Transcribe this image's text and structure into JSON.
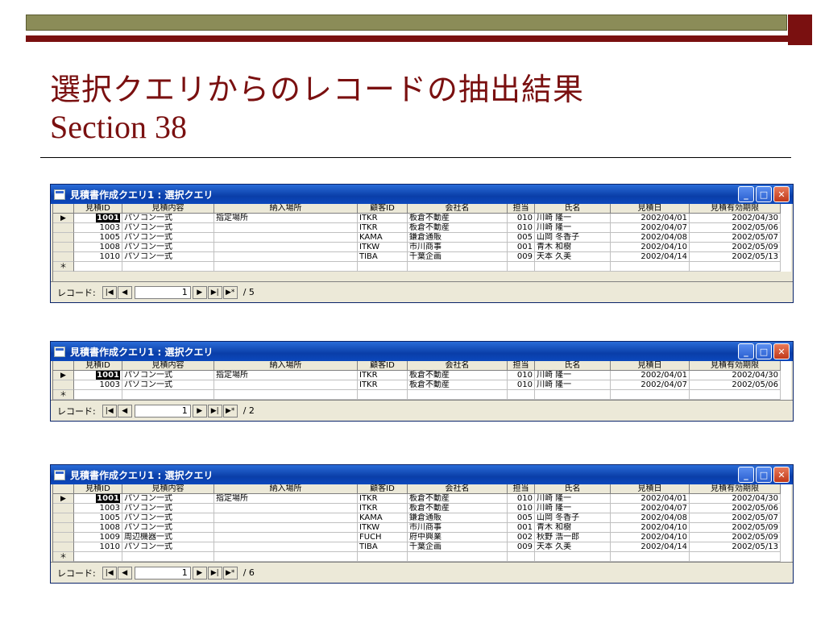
{
  "slide": {
    "title": "選択クエリからのレコードの抽出結果",
    "subtitle": "Section 38"
  },
  "windows": [
    {
      "title": "見積書作成クエリ1 : 選択クエリ",
      "columns": [
        "見積ID",
        "見積内容",
        "納入場所",
        "顧客ID",
        "会社名",
        "担当",
        "氏名",
        "見積日",
        "見積有効期限"
      ],
      "rows": [
        [
          "1001",
          "パソコン一式",
          "指定場所",
          "ITKR",
          "板倉不動産",
          "010",
          "川崎 隆一",
          "2002/04/01",
          "2002/04/30"
        ],
        [
          "1003",
          "パソコン一式",
          "",
          "ITKR",
          "板倉不動産",
          "010",
          "川崎 隆一",
          "2002/04/07",
          "2002/05/06"
        ],
        [
          "1005",
          "パソコン一式",
          "",
          "KAMA",
          "鎌倉通販",
          "005",
          "山岡 冬香子",
          "2002/04/08",
          "2002/05/07"
        ],
        [
          "1008",
          "パソコン一式",
          "",
          "ITKW",
          "市川商事",
          "001",
          "青木 和樹",
          "2002/04/10",
          "2002/05/09"
        ],
        [
          "1010",
          "パソコン一式",
          "",
          "TIBA",
          "千葉企画",
          "009",
          "天本 久美",
          "2002/04/14",
          "2002/05/13"
        ]
      ],
      "nav": {
        "label": "レコード:",
        "current": "1",
        "total": "/ 5"
      }
    },
    {
      "title": "見積書作成クエリ1 : 選択クエリ",
      "columns": [
        "見積ID",
        "見積内容",
        "納入場所",
        "顧客ID",
        "会社名",
        "担当",
        "氏名",
        "見積日",
        "見積有効期限"
      ],
      "rows": [
        [
          "1001",
          "パソコン一式",
          "指定場所",
          "ITKR",
          "板倉不動産",
          "010",
          "川崎 隆一",
          "2002/04/01",
          "2002/04/30"
        ],
        [
          "1003",
          "パソコン一式",
          "",
          "ITKR",
          "板倉不動産",
          "010",
          "川崎 隆一",
          "2002/04/07",
          "2002/05/06"
        ]
      ],
      "nav": {
        "label": "レコード:",
        "current": "1",
        "total": "/ 2"
      }
    },
    {
      "title": "見積書作成クエリ1 : 選択クエリ",
      "columns": [
        "見積ID",
        "見積内容",
        "納入場所",
        "顧客ID",
        "会社名",
        "担当",
        "氏名",
        "見積日",
        "見積有効期限"
      ],
      "rows": [
        [
          "1001",
          "パソコン一式",
          "指定場所",
          "ITKR",
          "板倉不動産",
          "010",
          "川崎 隆一",
          "2002/04/01",
          "2002/04/30"
        ],
        [
          "1003",
          "パソコン一式",
          "",
          "ITKR",
          "板倉不動産",
          "010",
          "川崎 隆一",
          "2002/04/07",
          "2002/05/06"
        ],
        [
          "1005",
          "パソコン一式",
          "",
          "KAMA",
          "鎌倉通販",
          "005",
          "山岡 冬香子",
          "2002/04/08",
          "2002/05/07"
        ],
        [
          "1008",
          "パソコン一式",
          "",
          "ITKW",
          "市川商事",
          "001",
          "青木 和樹",
          "2002/04/10",
          "2002/05/09"
        ],
        [
          "1009",
          "周辺機器一式",
          "",
          "FUCH",
          "府中興業",
          "002",
          "秋野 浩一郎",
          "2002/04/10",
          "2002/05/09"
        ],
        [
          "1010",
          "パソコン一式",
          "",
          "TIBA",
          "千葉企画",
          "009",
          "天本 久美",
          "2002/04/14",
          "2002/05/13"
        ]
      ],
      "nav": {
        "label": "レコード:",
        "current": "1",
        "total": "/ 6"
      }
    }
  ],
  "icons": {
    "minimize": "minimize-icon",
    "maximize": "maximize-icon",
    "close": "close-icon",
    "nav_first": "first-record-icon",
    "nav_prev": "prev-record-icon",
    "nav_next": "next-record-icon",
    "nav_last": "last-record-icon",
    "nav_new": "new-record-icon"
  },
  "colors": {
    "title_text": "#7a1010",
    "titlebar": "#0a3ea8",
    "olive_bar": "#8b8c58"
  }
}
